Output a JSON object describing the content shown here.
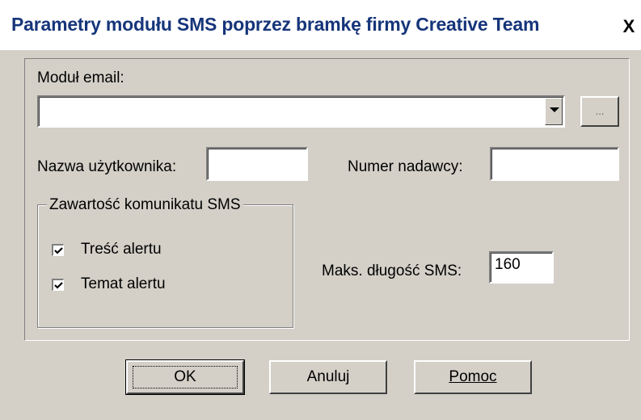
{
  "window": {
    "title": "Parametry modułu SMS poprzez bramkę firmy Creative Team",
    "close_label": "X"
  },
  "email_module": {
    "label": "Moduł email:",
    "value": "",
    "browse_label": "..."
  },
  "username": {
    "label": "Nazwa użytkownika:",
    "value": ""
  },
  "sender_number": {
    "label": "Numer nadawcy:",
    "value": ""
  },
  "sms_content": {
    "legend": "Zawartość komunikatu SMS",
    "alert_body": {
      "label": "Treść alertu",
      "checked": true
    },
    "alert_subject": {
      "label": "Temat alertu",
      "checked": true
    }
  },
  "max_length": {
    "label": "Maks. długość SMS:",
    "value": "160"
  },
  "buttons": {
    "ok": "OK",
    "cancel": "Anuluj",
    "help": "Pomoc"
  }
}
